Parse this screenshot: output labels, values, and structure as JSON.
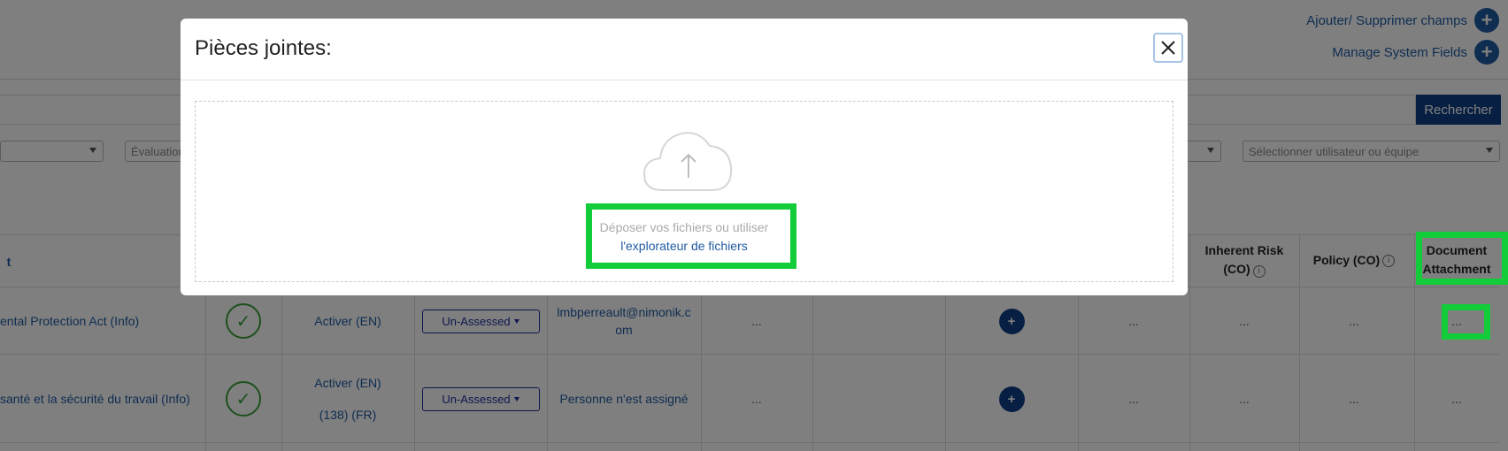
{
  "header": {
    "add_remove_fields": "Ajouter/ Supprimer champs",
    "manage_system_fields": "Manage System Fields",
    "plus_symbol": "+"
  },
  "search": {
    "button_label": "Rechercher"
  },
  "filters": {
    "evaluation_placeholder": "Évaluation",
    "user_team_placeholder": "Sélectionner utilisateur ou équipe"
  },
  "table": {
    "headers": {
      "name": "t",
      "inherent_risk": "Inherent Risk",
      "inherent_risk_sub": "(CO)",
      "policy": "Policy (CO)",
      "document_attachment_1": "Document",
      "document_attachment_2": "Attachment",
      "info_symbol": "i"
    },
    "rows": [
      {
        "name": "ental Protection Act (Info)",
        "check": "✓",
        "activate_1": "Activer (EN)",
        "activate_2": "",
        "status": "Un-Assessed",
        "assignee_1": "lmbperreault@nimonik.c",
        "assignee_2": "om",
        "col_a": "...",
        "plus": "+",
        "col_b": "...",
        "col_c": "...",
        "col_d": "...",
        "attachment": "..."
      },
      {
        "name": "santé et la sécurité du travail (Info)",
        "check": "✓",
        "activate_1": "Activer (EN)",
        "activate_2": "(138) (FR)",
        "status": "Un-Assessed",
        "assignee_1": "Personne n'est assigné",
        "assignee_2": "",
        "col_a": "...",
        "plus": "+",
        "col_b": "...",
        "col_c": "...",
        "col_d": "...",
        "attachment": "..."
      }
    ]
  },
  "modal": {
    "title": "Pièces jointes:",
    "drop_hint": "Déposer vos fichiers ou utiliser",
    "browse_link": "l'explorateur de fichiers"
  },
  "colors": {
    "primary": "#1f5ba3",
    "dark_primary": "#0f3f86",
    "highlight": "#12cc39",
    "check_green": "#3aa13a"
  }
}
